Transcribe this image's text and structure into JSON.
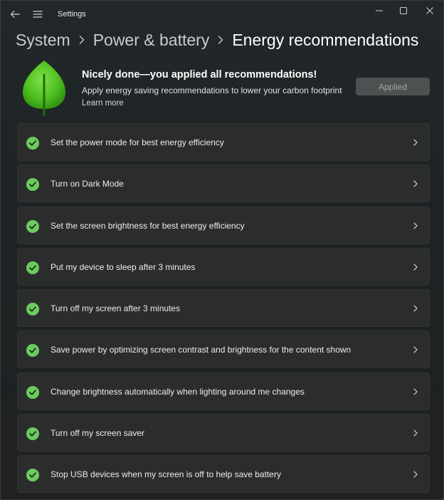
{
  "window": {
    "app_title": "Settings"
  },
  "breadcrumb": {
    "items": [
      "System",
      "Power & battery",
      "Energy recommendations"
    ]
  },
  "header": {
    "title": "Nicely done—you applied all recommendations!",
    "description": "Apply energy saving recommendations to lower your carbon footprint",
    "learn_more": "Learn more",
    "applied_button": "Applied"
  },
  "recommendations": [
    {
      "label": "Set the power mode for best energy efficiency",
      "status": "applied"
    },
    {
      "label": "Turn on Dark Mode",
      "status": "applied"
    },
    {
      "label": "Set the screen brightness for best energy efficiency",
      "status": "applied"
    },
    {
      "label": "Put my device to sleep after 3 minutes",
      "status": "applied"
    },
    {
      "label": "Turn off my screen after 3 minutes",
      "status": "applied"
    },
    {
      "label": "Save power by optimizing screen contrast and brightness for the content shown",
      "status": "applied"
    },
    {
      "label": "Change brightness automatically when lighting around me changes",
      "status": "applied"
    },
    {
      "label": "Turn off my screen saver",
      "status": "applied"
    },
    {
      "label": "Stop USB devices when my screen is off to help save battery",
      "status": "applied"
    }
  ],
  "icons": {
    "back": "back-arrow-icon",
    "menu": "hamburger-menu-icon",
    "minimize": "minimize-icon",
    "maximize": "maximize-icon",
    "close": "close-icon",
    "leaf": "leaf-icon",
    "check": "checkmark-circle-icon",
    "chevron": "chevron-right-icon"
  },
  "colors": {
    "accent_check": "#6ccb5f",
    "leaf_green": "#4fbf1f",
    "card_background": "#2b2d2d",
    "applied_button_bg": "#4d5151"
  }
}
